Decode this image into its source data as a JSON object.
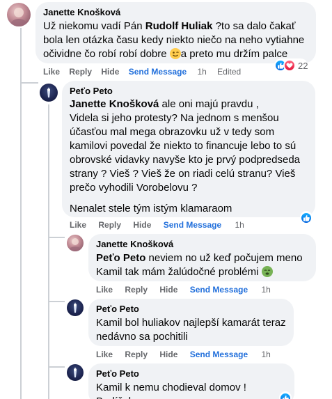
{
  "comments": [
    {
      "author": "Janette Knošková",
      "text_1": "Už niekomu vadí Pán ",
      "mention": "Rudolf Huliak",
      "text_2": " ?to sa dalo čakať",
      "text_3": "bola len otázka času kedy niekto niečo na neho vytiahne",
      "text_4": "očividne čo robí robí dobre ",
      "text_5": "a preto mu držím palce",
      "emoji": "winking-face",
      "actions": {
        "like": "Like",
        "reply": "Reply",
        "hide": "Hide",
        "send": "Send Message",
        "time": "1h",
        "edited": "Edited"
      },
      "reactions": {
        "icons": [
          "like",
          "love"
        ],
        "count": "22"
      }
    },
    {
      "author": "Peťo Peto",
      "mention": "Janette Knošková",
      "text_1": " ale oni majú pravdu ,",
      "lines": [
        "Videla si jeho protesty? Na jednom s menšou",
        "účasťou mal mega obrazovku už v tedy som",
        "kamilovi povedal že niekto to financuje lebo to sú",
        "obrovské vidavky navyše kto je prvý podpredseda",
        "strany ? Vieš ? Vieš že on riadi celú stranu? Vieš",
        "prečo vyhodili Vorobelovu ?"
      ],
      "closing": "Nenalet stele tým istým klamaraom",
      "actions": {
        "like": "Like",
        "reply": "Reply",
        "hide": "Hide",
        "send": "Send Message",
        "time": "1h"
      },
      "reactions": {
        "icons": [
          "like"
        ]
      }
    }
  ],
  "replies": [
    {
      "author": "Janette Knošková",
      "mention": "Peťo Peto",
      "text_1": " neviem no už keď počujem meno",
      "text_2": "Kamil tak mám žalúdočné problémi ",
      "emoji": "nauseated-face",
      "actions": {
        "like": "Like",
        "reply": "Reply",
        "hide": "Hide",
        "send": "Send Message",
        "time": "1h"
      }
    },
    {
      "author": "Peťo Peto",
      "text_1": "Kamil bol huliakov najlepší kamarát teraz",
      "text_2": "nedávno sa pochitili",
      "actions": {
        "like": "Like",
        "reply": "Reply",
        "hide": "Hide",
        "send": "Send Message",
        "time": "1h"
      }
    },
    {
      "author": "Peťo Peto",
      "text_1": "Kamil k nemu chodieval domov ! Budíček",
      "reactions": {
        "icons": [
          "like"
        ]
      }
    }
  ],
  "colors": {
    "bubble": "#f0f2f5",
    "link": "#216fdb",
    "meta": "#65676b",
    "like": "#0866ff",
    "love": "#f33e58"
  }
}
